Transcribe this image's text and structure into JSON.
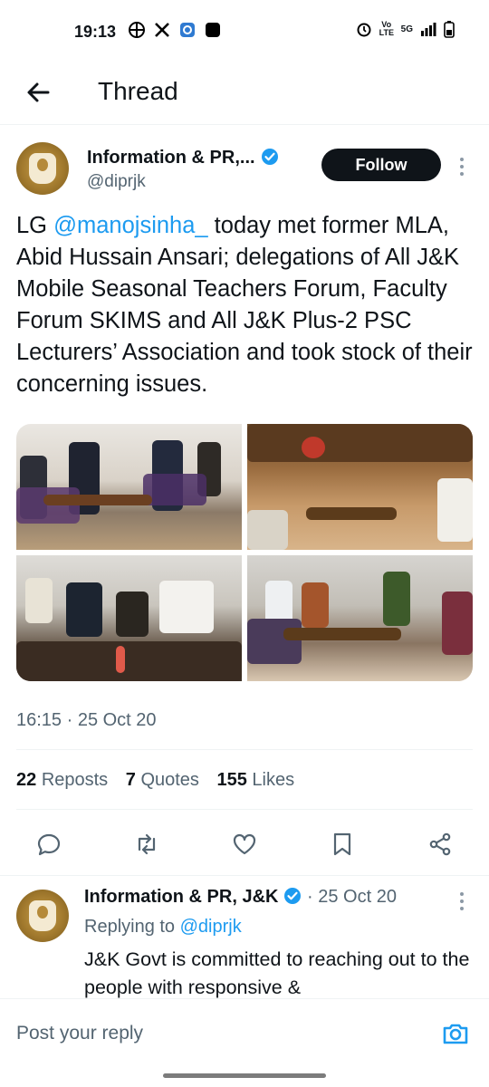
{
  "status_bar": {
    "time": "19:13",
    "left_icons": [
      "grid-icon",
      "x-logo-icon",
      "app-icon",
      "square-icon"
    ],
    "right_icons": [
      "alarm-icon",
      "volte-icon",
      "5g-signal-icon",
      "battery-icon"
    ],
    "volte_label": "Vo LTE",
    "network_label": "5G"
  },
  "topbar": {
    "back_icon": "arrow-left-icon",
    "title": "Thread"
  },
  "main_tweet": {
    "author_name": "Information & PR,...",
    "handle": "@diprjk",
    "follow_label": "Follow",
    "text_prefix": "LG ",
    "mention": "@manojsinha_",
    "text_rest": " today met former MLA, Abid Hussain Ansari; delegations of All J&K Mobile Seasonal Teachers Forum, Faculty Forum SKIMS and All J&K Plus-2 PSC Lecturers’ Association and took stock of their concerning issues.",
    "timestamp": "16:15 · 25 Oct 20",
    "stats": {
      "reposts_count": "22",
      "reposts_label": "Reposts",
      "quotes_count": "7",
      "quotes_label": "Quotes",
      "likes_count": "155",
      "likes_label": "Likes"
    },
    "action_icons": [
      "reply-icon",
      "repost-icon",
      "like-icon",
      "bookmark-icon",
      "share-icon"
    ]
  },
  "reply_tweet": {
    "author_name": "Information & PR, J&K",
    "date": " · 25 Oct 20",
    "replying_prefix": "Replying to ",
    "replying_handle": "@diprjk",
    "text": "J&K Govt is committed to reaching out to the people with responsive &"
  },
  "reply_bar": {
    "placeholder": "Post your reply",
    "camera_icon": "camera-icon"
  },
  "colors": {
    "accent": "#1d9bf0",
    "text": "#0f1419",
    "secondary_text": "#536471",
    "follow_bg": "#0f1419"
  }
}
